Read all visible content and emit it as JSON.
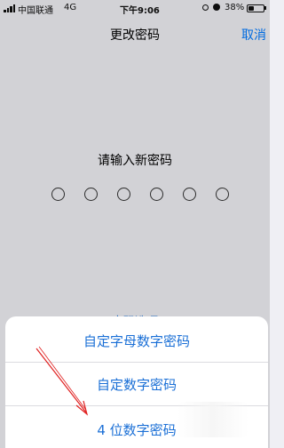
{
  "status_bar": {
    "carrier": "中国联通",
    "network": "4G",
    "time": "下午9:06",
    "battery_percent": "38%",
    "battery_level": 0.38,
    "icons": [
      "signal-icon",
      "lock-rotation-icon",
      "alarm-icon",
      "battery-icon"
    ]
  },
  "nav": {
    "title": "更改密码",
    "cancel_label": "取消"
  },
  "passcode": {
    "prompt": "请输入新密码",
    "digit_count": 6,
    "options_link": "密码选项"
  },
  "action_sheet": {
    "options": [
      "自定字母数字密码",
      "自定数字密码",
      "4 位数字密码"
    ]
  },
  "colors": {
    "accent": "#007aff",
    "option_text": "#1a6fd6",
    "annotation": "#e02020"
  }
}
